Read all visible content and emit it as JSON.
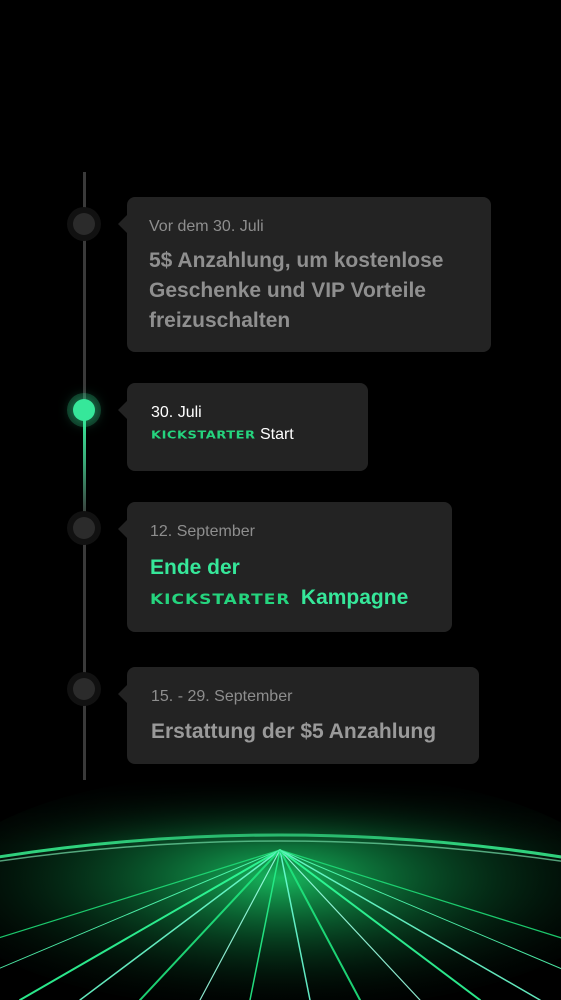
{
  "timeline": {
    "items": [
      {
        "date": "Vor dem 30. Juli",
        "headline": "5$ Anzahlung, um kostenlose Geschenke und VIP Vorteile freizuschalten"
      },
      {
        "date": "30. Juli",
        "logo_text": "KICKSTARTER",
        "suffix": "Start"
      },
      {
        "date": "12. September",
        "headline_line1": "Ende der",
        "logo_text": "KICKSTARTER",
        "suffix": "Kampagne"
      },
      {
        "date": "15. - 29. September",
        "headline": "Erstattung der $5 Anzahlung"
      }
    ]
  },
  "colors": {
    "accent": "#36e79a",
    "card": "#232323",
    "background": "#000000"
  },
  "icons": {
    "arrow": "arrow-down-icon",
    "node": "timeline-node-icon"
  }
}
